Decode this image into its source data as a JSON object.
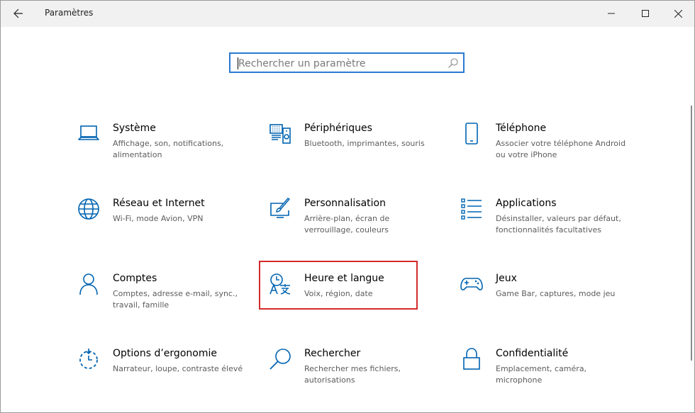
{
  "window": {
    "title": "Paramètres"
  },
  "search": {
    "placeholder": "Rechercher un paramètre",
    "value": ""
  },
  "colors": {
    "accent": "#0063b1",
    "highlight": "#d42a2a",
    "titlebar": "#f1f1f1"
  },
  "tiles": [
    {
      "name": "Système",
      "desc": "Affichage, son, notifications, alimentation",
      "icon": "laptop-icon"
    },
    {
      "name": "Périphériques",
      "desc": "Bluetooth, imprimantes, souris",
      "icon": "devices-icon"
    },
    {
      "name": "Téléphone",
      "desc": "Associer votre téléphone Android ou votre iPhone",
      "icon": "phone-icon"
    },
    {
      "name": "Réseau et Internet",
      "desc": "Wi-Fi, mode Avion, VPN",
      "icon": "globe-icon"
    },
    {
      "name": "Personnalisation",
      "desc": "Arrière-plan, écran de verrouillage, couleurs",
      "icon": "paint-icon"
    },
    {
      "name": "Applications",
      "desc": "Désinstaller, valeurs par défaut, fonctionnalités facultatives",
      "icon": "apps-list-icon"
    },
    {
      "name": "Comptes",
      "desc": "Comptes, adresse e-mail, sync., travail, famille",
      "icon": "person-icon"
    },
    {
      "name": "Heure et langue",
      "desc": "Voix, région, date",
      "icon": "time-language-icon"
    },
    {
      "name": "Jeux",
      "desc": "Game Bar, captures, mode jeu",
      "icon": "gamepad-icon"
    },
    {
      "name": "Options d’ergonomie",
      "desc": "Narrateur, loupe, contraste élevé",
      "icon": "ease-of-access-icon"
    },
    {
      "name": "Rechercher",
      "desc": "Rechercher mes fichiers, autorisations",
      "icon": "search-icon"
    },
    {
      "name": "Confidentialité",
      "desc": "Emplacement, caméra, microphone",
      "icon": "lock-icon"
    }
  ]
}
